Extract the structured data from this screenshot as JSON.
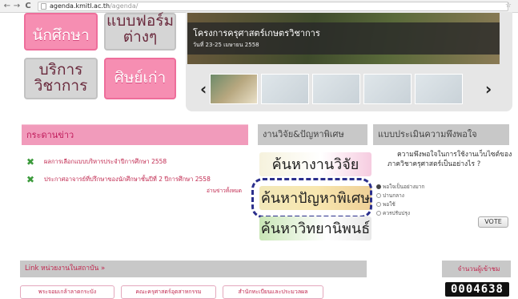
{
  "browser": {
    "back": "←",
    "forward": "→",
    "reload": "C",
    "url_host": "agenda.kmitl.ac.th",
    "url_path": "/agenda/",
    "star": "☆"
  },
  "tiles": {
    "students": "นักศึกษา",
    "forms_line1": "แบบฟอร์ม",
    "forms_line2": "ต่างๆ",
    "services_line1": "บริการ",
    "services_line2": "วิชาการ",
    "alumni": "ศิษย์เก่า"
  },
  "banner": {
    "title": "โครงการครุศาสตร์เกษตรวิชาการ",
    "date": "วันที่ 23-25 เมษายน 2558",
    "prev": "‹",
    "next": "›"
  },
  "news": {
    "header": "กระดานข่าว",
    "items": [
      "ผลการเลือกแบบบริหารประจำปีการศึกษา 2558",
      "ประกาศอาจารย์ที่ปรึกษาของนักศึกษาชั้นปีที่ 2 ปีการศึกษา 2558"
    ],
    "item_icon": "✖",
    "read_all": "อ่านข่าวทั้งหมด"
  },
  "research": {
    "header": "งานวิจัย&ปัญหาพิเศษ",
    "search_research": "ค้นหางานวิจัย",
    "search_special_problem": "ค้นหาปัญหาพิเศษ",
    "search_thesis": "ค้นหาวิทยานิพนธ์"
  },
  "survey": {
    "header": "แบบประเมินความพึงพอใจ",
    "question": "ความพึงพอใจในการใช้งานเว็บไซต์ของภาควิชาครุศาสตร์เป็นอย่างไร ?",
    "options": [
      "พอใจเป็นอย่างมาก",
      "ปานกลาง",
      "พอใช้",
      "ควรปรับปรุง"
    ],
    "selected_index": 0,
    "vote_label": "VOTE"
  },
  "links": {
    "header": "Link หน่วยงานในสถาบัน »",
    "buttons": [
      "พระจอมเกล้าลาดกระบัง",
      "คณะครุศาสตร์อุตสาหกรรม",
      "สำนักทะเบียนและประมวลผล"
    ]
  },
  "visitors": {
    "header": "จำนวนผู้เข้าชม",
    "count": "0004638"
  }
}
